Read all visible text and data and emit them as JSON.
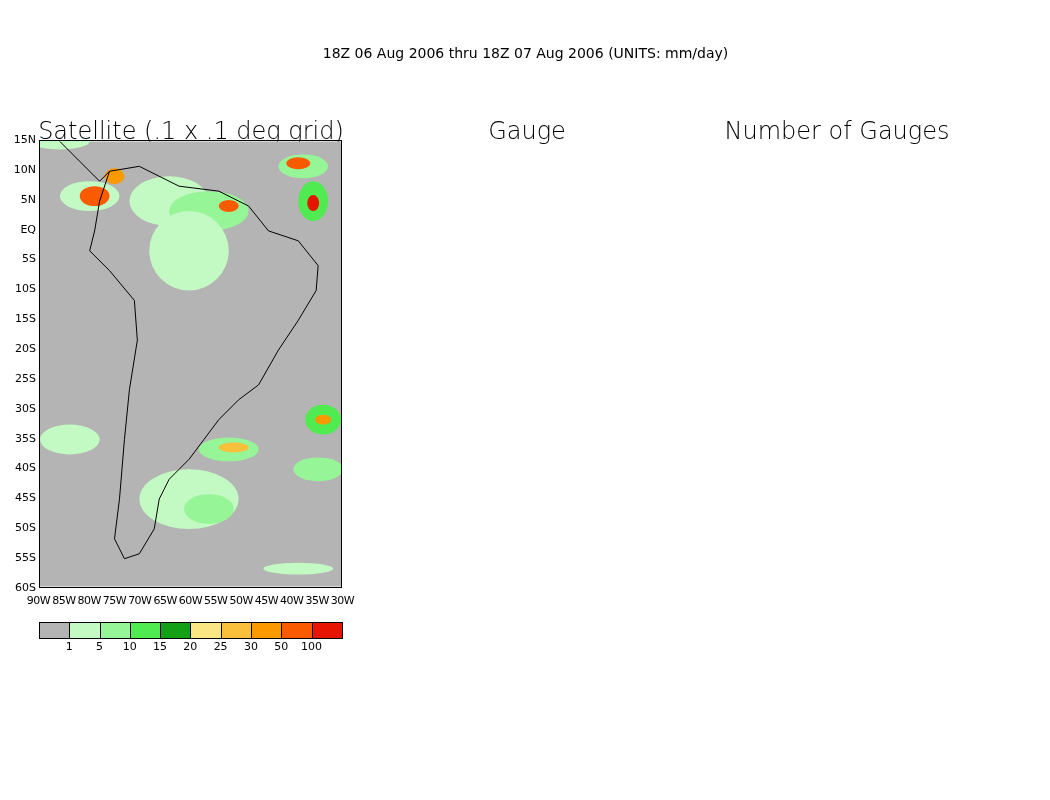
{
  "title": "18Z 06 Aug 2006 thru 18Z 07 Aug 2006 (UNITS: mm/day)",
  "panels": [
    {
      "title": "Satellite (.1 x .1 deg grid)"
    },
    {
      "title": "Gauge"
    },
    {
      "title": "Number of Gauges"
    }
  ],
  "map": {
    "y_ticks": [
      "15N",
      "10N",
      "5N",
      "EQ",
      "5S",
      "10S",
      "15S",
      "20S",
      "25S",
      "30S",
      "35S",
      "40S",
      "45S",
      "50S",
      "55S",
      "60S"
    ],
    "x_ticks": [
      "90W",
      "85W",
      "80W",
      "75W",
      "70W",
      "65W",
      "60W",
      "55W",
      "50W",
      "45W",
      "40W",
      "35W",
      "30W"
    ]
  },
  "legend": {
    "boxes": [
      {
        "color": "#b4b4b4"
      },
      {
        "color": "#c3f9c3"
      },
      {
        "color": "#96f596"
      },
      {
        "color": "#50eb50"
      },
      {
        "color": "#14a014"
      },
      {
        "color": "#fae682"
      },
      {
        "color": "#fac03c"
      },
      {
        "color": "#fa9a00"
      },
      {
        "color": "#fa5a00"
      },
      {
        "color": "#e61400"
      }
    ],
    "labels": [
      "1",
      "5",
      "10",
      "15",
      "20",
      "25",
      "30",
      "50",
      "100"
    ]
  }
}
